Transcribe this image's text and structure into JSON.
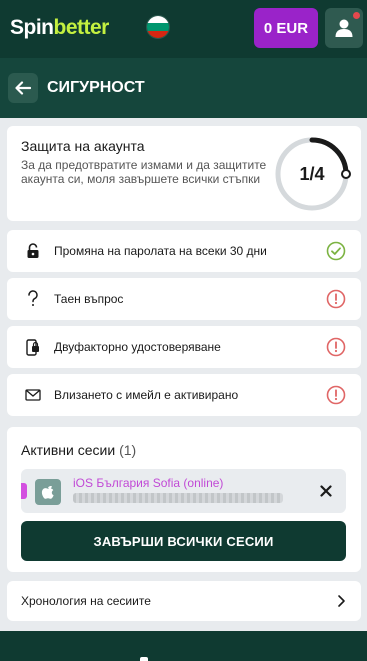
{
  "brand": {
    "name_part1": "Spin",
    "name_part2": "better"
  },
  "header": {
    "balance": "0 EUR",
    "flag_colors": [
      "#ffffff",
      "#00966e",
      "#d62612"
    ]
  },
  "page": {
    "title": "СИГУРНОСТ"
  },
  "protection": {
    "title": "Защита на акаунта",
    "description": "За да предотвратите измами и да защитите акаунта си, моля завършете всички стъпки",
    "progress_text": "1/4",
    "progress_fraction": 0.25
  },
  "steps": [
    {
      "label": "Промяна на паролата на всеки 30 дни",
      "icon": "lock-icon",
      "status": "done"
    },
    {
      "label": "Таен въпрос",
      "icon": "question-icon",
      "status": "warning"
    },
    {
      "label": "Двуфакторно удостоверяване",
      "icon": "phone-lock-icon",
      "status": "warning"
    },
    {
      "label": "Влизането с имейл е активирано",
      "icon": "mail-icon",
      "status": "warning"
    }
  ],
  "sessions": {
    "title": "Активни сесии",
    "count": "(1)",
    "items": [
      {
        "name": "iOS България Sofia (online)"
      }
    ],
    "end_all_label": "ЗАВЪРШИ ВСИЧКИ СЕСИИ"
  },
  "history": {
    "label": "Хронология на сесиите"
  },
  "colors": {
    "accent": "#9a23c9",
    "primary_dark": "#0f3a31",
    "success": "#7cb342",
    "warning": "#e06666"
  }
}
